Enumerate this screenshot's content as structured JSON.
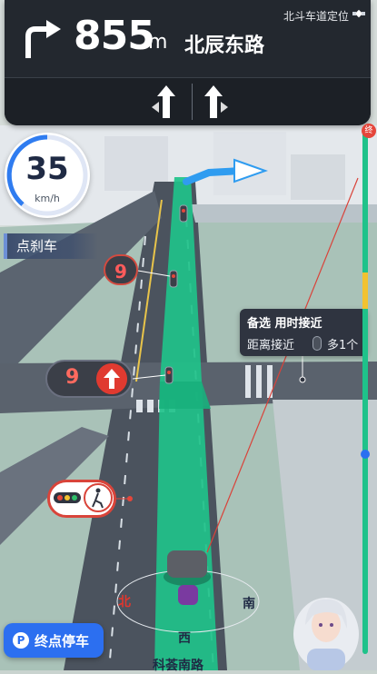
{
  "guidance": {
    "distance": "855",
    "unit": "m",
    "road": "北辰东路",
    "positioning": "北斗车道定位"
  },
  "speed": {
    "value": "35",
    "unit": "km/h"
  },
  "hint": {
    "brake": "点刹车"
  },
  "traffic_lights": {
    "first_countdown": "9",
    "second_countdown": "9"
  },
  "alt_route": {
    "title": "备选 用时接近",
    "detail_prefix": "距离接近",
    "detail_suffix": "多1个"
  },
  "compass": {
    "north": "北",
    "south": "南",
    "west": "西"
  },
  "buttons": {
    "park": "终点停车",
    "park_icon": "P"
  },
  "progress": {
    "end_label": "终"
  },
  "bottom_street": "科荟南路",
  "colors": {
    "route": "#1fc28a",
    "alt_route": "#2f9cf0",
    "panel": "#23282f",
    "accent": "#2c6ff0"
  }
}
